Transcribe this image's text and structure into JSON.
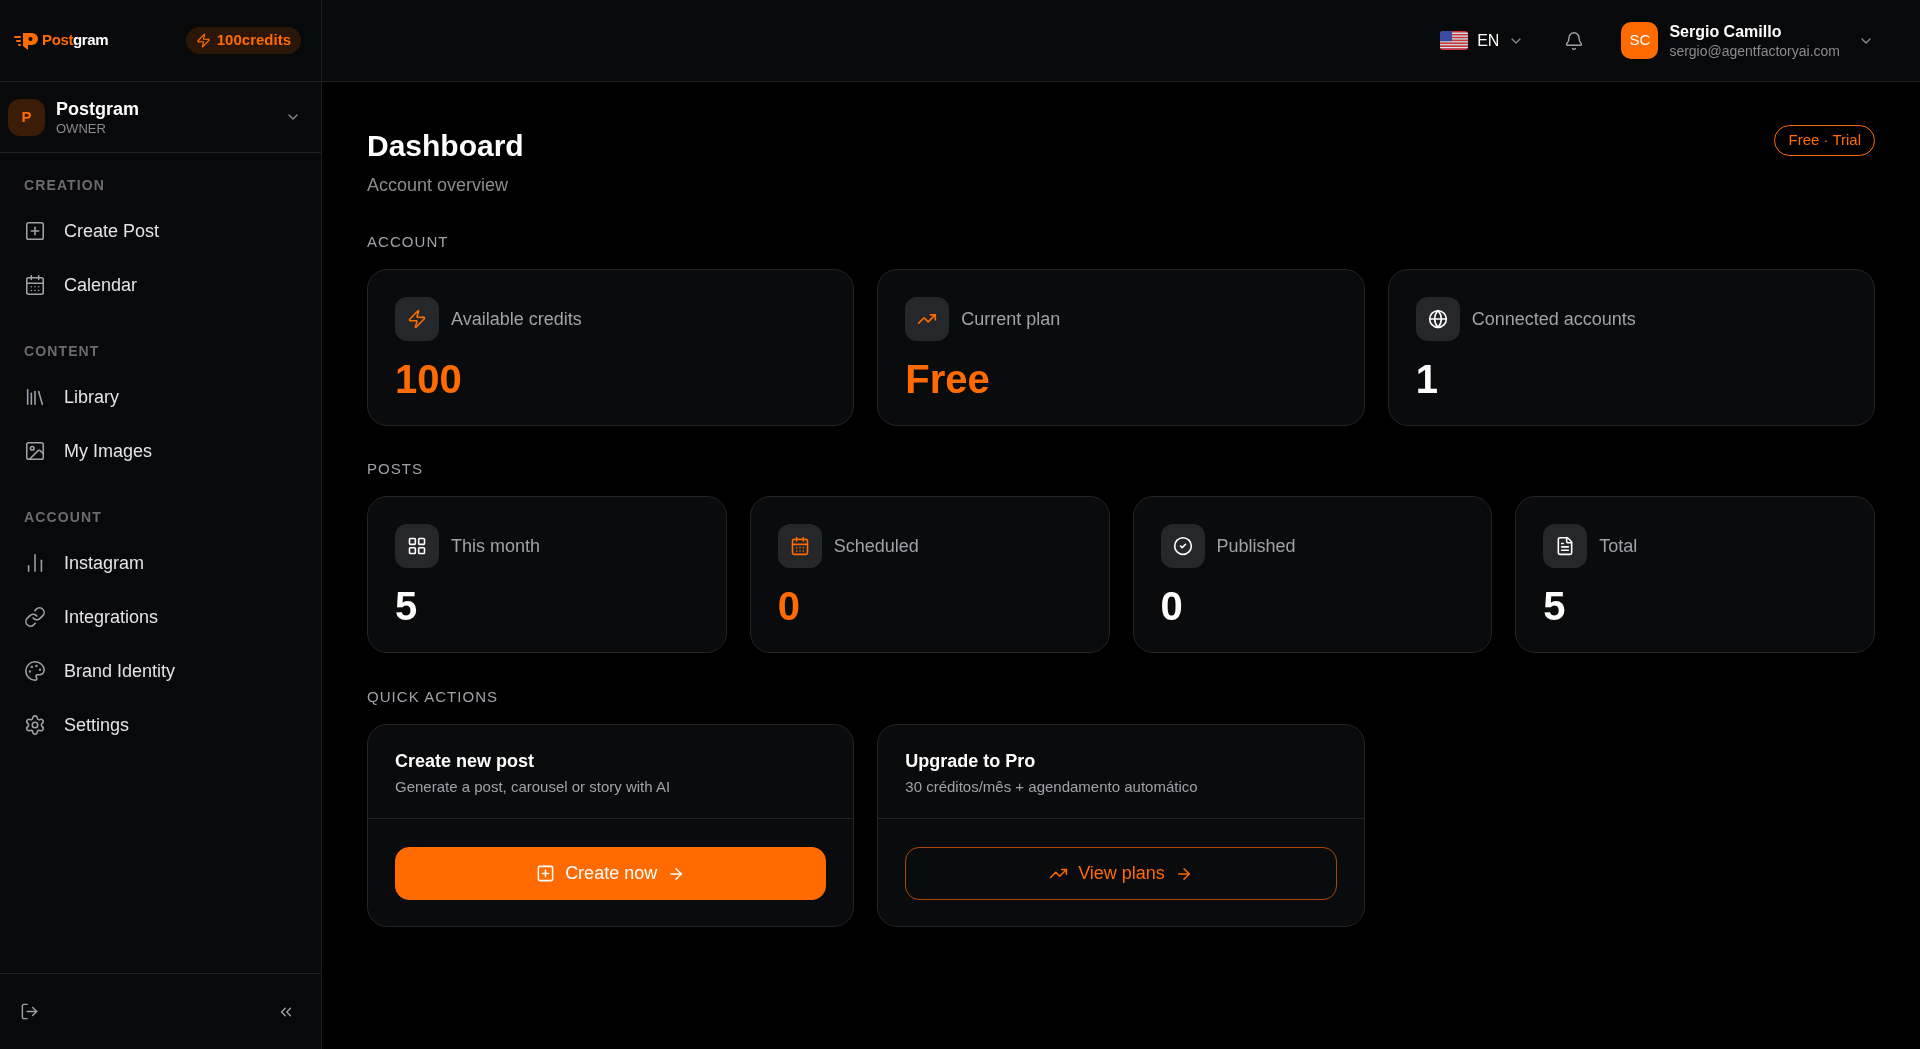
{
  "sidebar": {
    "logo": {
      "accent": "Post",
      "rest": "gram"
    },
    "credits_badge": "100credits",
    "workspace": {
      "initial": "P",
      "name": "Postgram",
      "role": "OWNER"
    },
    "sections": [
      {
        "title": "CREATION",
        "items": [
          {
            "label": "Create Post",
            "selected": false
          },
          {
            "label": "Calendar",
            "selected": false
          }
        ]
      },
      {
        "title": "CONTENT",
        "items": [
          {
            "label": "Library",
            "selected": false
          },
          {
            "label": "My Images",
            "selected": false
          }
        ]
      },
      {
        "title": "ACCOUNT",
        "items": [
          {
            "label": "Instagram",
            "selected": false
          },
          {
            "label": "Integrations",
            "selected": false
          },
          {
            "label": "Brand Identity",
            "selected": false
          },
          {
            "label": "Settings",
            "selected": false
          }
        ]
      }
    ]
  },
  "header": {
    "language": "EN",
    "user": {
      "initials": "SC",
      "name": "Sergio Camillo",
      "email": "sergio@agentfactoryai.com"
    }
  },
  "page": {
    "title": "Dashboard",
    "subtitle": "Account overview",
    "plan_badge": "Free · Trial"
  },
  "account": {
    "title": "ACCOUNT",
    "cards": [
      {
        "label": "Available credits",
        "value": "100",
        "highlight": true
      },
      {
        "label": "Current plan",
        "value": "Free",
        "highlight": true
      },
      {
        "label": "Connected accounts",
        "value": "1",
        "highlight": false
      }
    ]
  },
  "posts": {
    "title": "POSTS",
    "cards": [
      {
        "label": "This month",
        "value": "5",
        "highlight": false
      },
      {
        "label": "Scheduled",
        "value": "0",
        "highlight": true
      },
      {
        "label": "Published",
        "value": "0",
        "highlight": false
      },
      {
        "label": "Total",
        "value": "5",
        "highlight": false
      }
    ]
  },
  "quick_actions": {
    "title": "QUICK ACTIONS",
    "cards": [
      {
        "title": "Create new post",
        "description": "Generate a post, carousel or story with AI",
        "button": {
          "label": "Create now",
          "kind": "primary"
        }
      },
      {
        "title": "Upgrade to Pro",
        "description": "30 créditos/mês + agendamento automático",
        "button": {
          "label": "View plans",
          "kind": "outline"
        }
      }
    ]
  }
}
